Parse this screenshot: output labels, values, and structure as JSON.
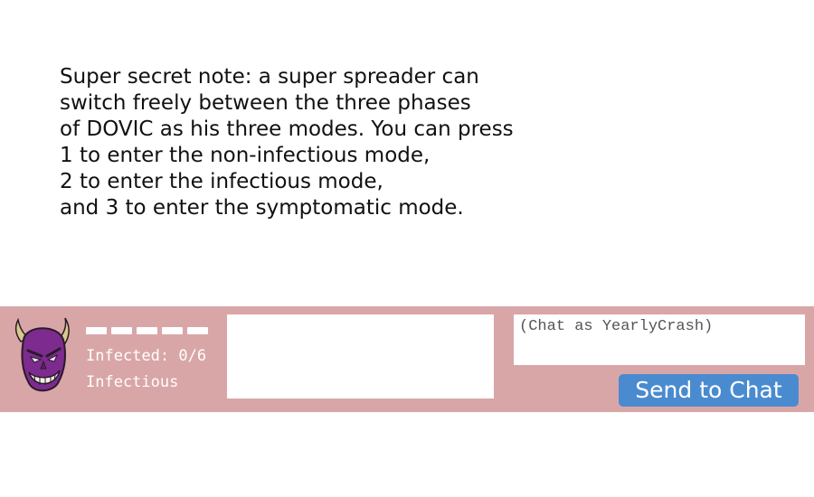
{
  "note": {
    "lines": [
      "Super secret note: a super spreader can",
      "switch freely between the three phases",
      "of DOVIC as his three modes. You can press",
      "1 to enter the non-infectious mode,",
      "2 to enter the infectious mode,",
      "and 3 to enter the symptomatic mode."
    ]
  },
  "hud": {
    "background_color": "#d9a6a8",
    "avatar_icon": "purple-demon-face-icon",
    "health": {
      "segments_total": 5,
      "segments_filled": 5
    },
    "infected_label": "Infected: 0/6",
    "mode_label": "Infectious",
    "chat": {
      "placeholder": "(Chat as YearlyCrash)",
      "value": "",
      "send_label": "Send to Chat",
      "send_color": "#4a8bd0"
    }
  }
}
